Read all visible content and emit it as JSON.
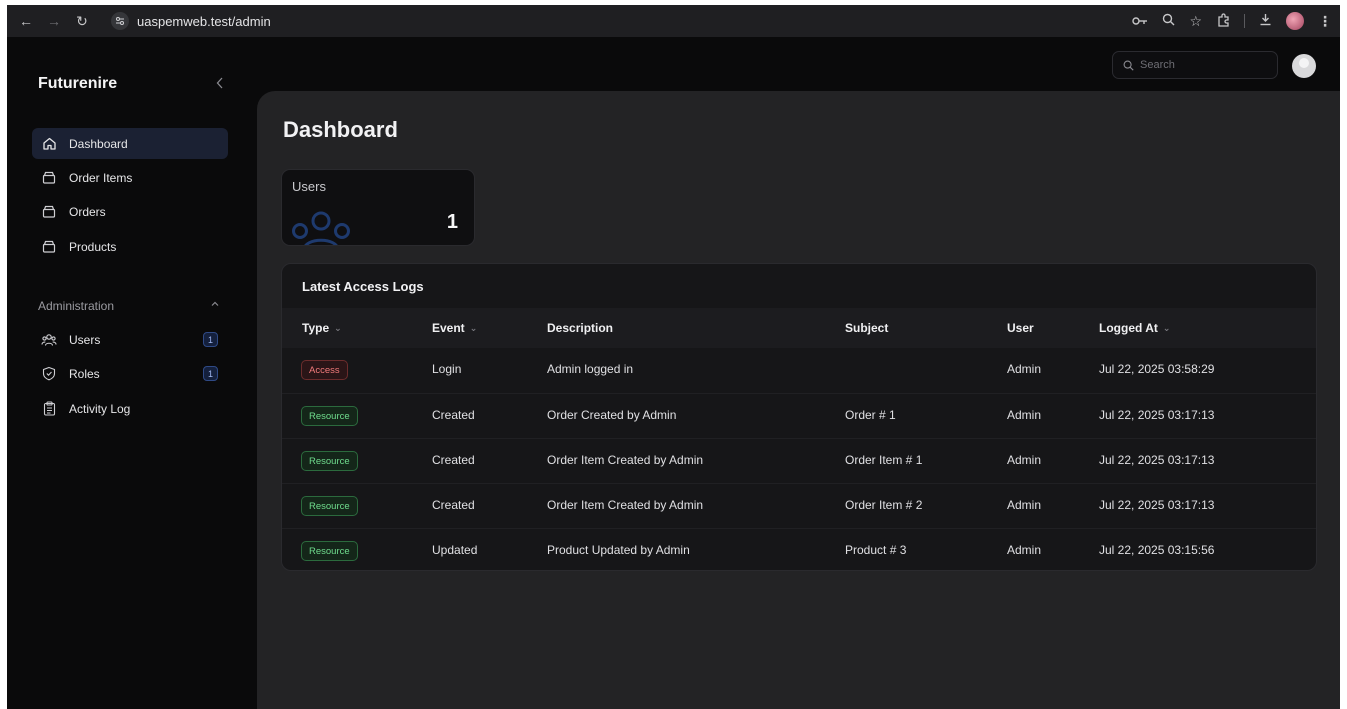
{
  "browser": {
    "url": "uaspemweb.test/admin"
  },
  "sidebar": {
    "brand": "Futurenire",
    "items": [
      {
        "label": "Dashboard",
        "icon": "home-icon",
        "active": true
      },
      {
        "label": "Order Items",
        "icon": "box-icon"
      },
      {
        "label": "Orders",
        "icon": "box-icon"
      },
      {
        "label": "Products",
        "icon": "box-icon"
      }
    ],
    "admin_group": {
      "label": "Administration",
      "items": [
        {
          "label": "Users",
          "icon": "users-icon",
          "badge": "1"
        },
        {
          "label": "Roles",
          "icon": "shield-icon",
          "badge": "1"
        },
        {
          "label": "Activity Log",
          "icon": "clipboard-icon"
        }
      ]
    }
  },
  "topbar": {
    "search_placeholder": "Search"
  },
  "main": {
    "title": "Dashboard",
    "stat_card": {
      "label": "Users",
      "value": "1"
    },
    "logs": {
      "title": "Latest Access Logs",
      "columns": [
        "Type",
        "Event",
        "Description",
        "Subject",
        "User",
        "Logged At"
      ],
      "rows": [
        {
          "type": "Access",
          "type_kind": "access",
          "event": "Login",
          "description": "Admin logged in",
          "subject": "",
          "user": "Admin",
          "logged_at": "Jul 22, 2025 03:58:29"
        },
        {
          "type": "Resource",
          "type_kind": "resource",
          "event": "Created",
          "description": "Order Created by Admin",
          "subject": "Order # 1",
          "user": "Admin",
          "logged_at": "Jul 22, 2025 03:17:13"
        },
        {
          "type": "Resource",
          "type_kind": "resource",
          "event": "Created",
          "description": "Order Item Created by Admin",
          "subject": "Order Item # 1",
          "user": "Admin",
          "logged_at": "Jul 22, 2025 03:17:13"
        },
        {
          "type": "Resource",
          "type_kind": "resource",
          "event": "Created",
          "description": "Order Item Created by Admin",
          "subject": "Order Item # 2",
          "user": "Admin",
          "logged_at": "Jul 22, 2025 03:17:13"
        },
        {
          "type": "Resource",
          "type_kind": "resource",
          "event": "Updated",
          "description": "Product Updated by Admin",
          "subject": "Product # 3",
          "user": "Admin",
          "logged_at": "Jul 22, 2025 03:15:56"
        }
      ]
    }
  },
  "colors": {
    "sidebar_active": "#1b2133",
    "access_badge": "#f07a7a",
    "resource_badge": "#6fdc8d",
    "nav_count_badge": "#9fb6ee"
  }
}
